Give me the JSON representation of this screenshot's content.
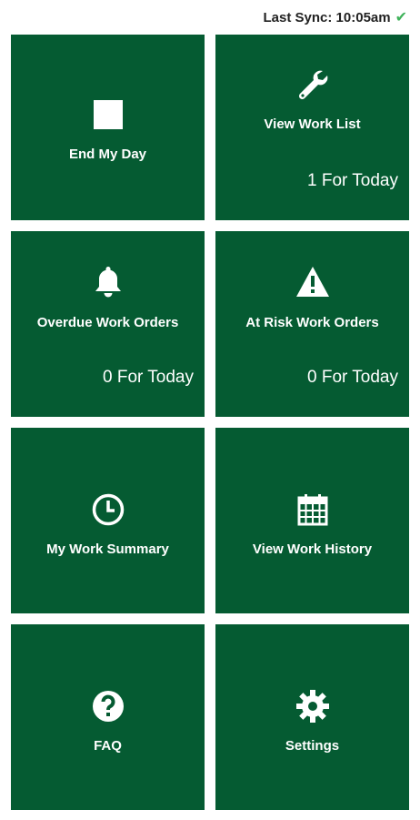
{
  "status": {
    "last_sync_label": "Last Sync:",
    "last_sync_time": "10:05am",
    "sync_icon": "check-icon",
    "sync_color": "#3fb25a"
  },
  "theme": {
    "tile_color": "#055b32",
    "text_color": "#ffffff"
  },
  "tiles": [
    {
      "label": "End My Day",
      "icon": "stop-square-icon",
      "count": ""
    },
    {
      "label": "View Work List",
      "icon": "wrench-icon",
      "count": "1 For Today"
    },
    {
      "label": "Overdue Work Orders",
      "icon": "bell-icon",
      "count": "0 For Today"
    },
    {
      "label": "At Risk Work Orders",
      "icon": "warning-icon",
      "count": "0 For Today"
    },
    {
      "label": "My Work Summary",
      "icon": "clock-icon",
      "count": ""
    },
    {
      "label": "View Work History",
      "icon": "calendar-icon",
      "count": ""
    },
    {
      "label": "FAQ",
      "icon": "question-icon",
      "count": ""
    },
    {
      "label": "Settings",
      "icon": "gear-icon",
      "count": ""
    }
  ]
}
